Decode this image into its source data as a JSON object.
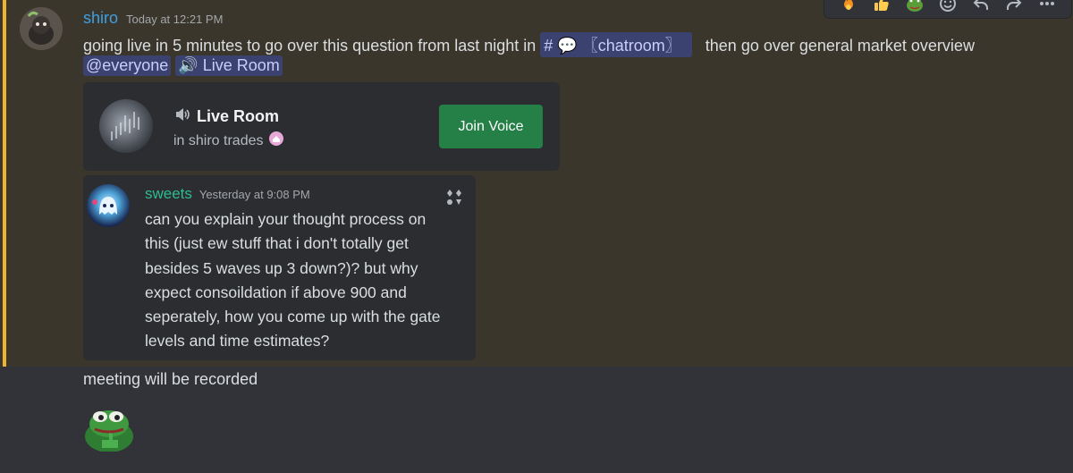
{
  "message": {
    "author": "shiro",
    "timestamp": "Today at 12:21 PM",
    "text_part1": "going live in 5 minutes to go over this question from last night in",
    "channel_mention": "# 💬 〖chatroom〗",
    "text_part2": "then go over general market overview",
    "everyone_mention": "@everyone",
    "voice_mention": "🔊 Live Room",
    "followup_text": "meeting will be recorded"
  },
  "voice_invite": {
    "title": "Live Room",
    "subtitle": "in shiro trades",
    "button_label": "Join Voice"
  },
  "quoted_message": {
    "author": "sweets",
    "timestamp": "Yesterday at 9:08 PM",
    "lines": [
      "can you explain your thought process on",
      "this (just ew stuff that i don't totally get",
      "besides 5 waves up 3 down?)? but why",
      "expect consoildation if above 900 and",
      "seperately, how you come up with the gate",
      "levels and time estimates?"
    ]
  },
  "reactions_bar": {
    "items": [
      "fire-emoji",
      "thumbs-up-emoji",
      "frog-emoji",
      "add-reaction-icon",
      "reply-icon",
      "forward-icon",
      "more-icon"
    ]
  },
  "colors": {
    "author_shiro": "#3ea0e3",
    "author_sweets": "#2dbd8f",
    "highlight_bar": "#f0b232",
    "join_button": "#248046",
    "mention_bg": "#3c4270"
  }
}
